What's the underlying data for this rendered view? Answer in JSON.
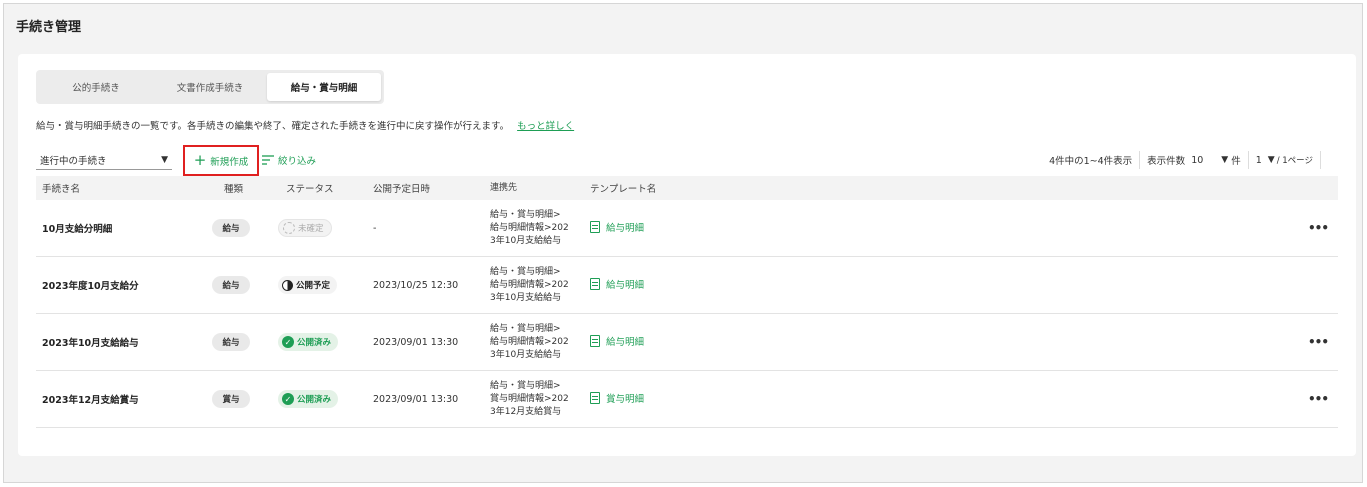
{
  "page": {
    "title": "手続き管理"
  },
  "tabs": [
    {
      "label": "公的手続き",
      "active": false
    },
    {
      "label": "文書作成手続き",
      "active": false
    },
    {
      "label": "給与・賞与明細",
      "active": true
    }
  ],
  "description": {
    "text": "給与・賞与明細手続きの一覧です。各手続きの編集や終了、確定された手続きを進行中に戻す操作が行えます。",
    "link": "もっと詳しく"
  },
  "toolbar": {
    "filter_value": "進行中の手続き",
    "new_label": "新規作成",
    "narrow_label": "絞り込み"
  },
  "pager": {
    "summary": "4件中の1~4件表示",
    "per_page_label": "表示件数",
    "per_page_value": "10",
    "per_page_unit": "件",
    "page_value": "1",
    "page_suffix": "/ 1ページ"
  },
  "table": {
    "headers": [
      "手続き名",
      "種類",
      "ステータス",
      "公開予定日時",
      "連携先",
      "テンプレート名"
    ],
    "rows": [
      {
        "name": "10月支給分明細",
        "type": "給与",
        "status": "未確定",
        "date": "-",
        "link1": "給与・賞与明細>",
        "link2": "給与明細情報>202",
        "link3": "3年10月支給給与",
        "template": "給与明細",
        "more": "•••"
      },
      {
        "name": "2023年度10月支給分",
        "type": "給与",
        "status": "公開予定",
        "date": "2023/10/25 12:30",
        "link1": "給与・賞与明細>",
        "link2": "給与明細情報>202",
        "link3": "3年10月支給給与",
        "template": "給与明細",
        "more": ""
      },
      {
        "name": "2023年10月支給給与",
        "type": "給与",
        "status": "公開済み",
        "date": "2023/09/01 13:30",
        "link1": "給与・賞与明細>",
        "link2": "給与明細情報>202",
        "link3": "3年10月支給給与",
        "template": "給与明細",
        "more": "•••"
      },
      {
        "name": "2023年12月支給賞与",
        "type": "賞与",
        "status": "公開済み",
        "date": "2023/09/01 13:30",
        "link1": "給与・賞与明細>",
        "link2": "賞与明細情報>202",
        "link3": "3年12月支給賞与",
        "template": "賞与明細",
        "more": "•••"
      }
    ]
  },
  "colors": {
    "accent": "#1e9e55",
    "highlight": "#e02020"
  }
}
